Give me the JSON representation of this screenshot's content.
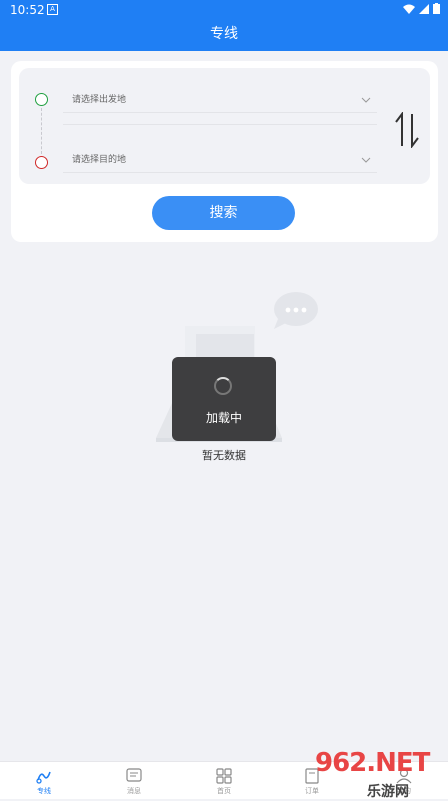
{
  "status_bar": {
    "time": "10:52",
    "notification_icon": "A"
  },
  "app_bar": {
    "title": "专线"
  },
  "route_form": {
    "from_placeholder": "请选择出发地",
    "to_placeholder": "请选择目的地",
    "search_label": "搜索",
    "from_dot_color": "#20a040",
    "to_dot_color": "#d02828"
  },
  "loading_toast": {
    "label": "加载中"
  },
  "empty_state": {
    "text": "暂无数据"
  },
  "tab_bar": {
    "items": [
      {
        "label": "专线",
        "icon": "route-icon",
        "active": true
      },
      {
        "label": "消息",
        "icon": "message-icon",
        "active": false
      },
      {
        "label": "首页",
        "icon": "grid-icon",
        "active": false
      },
      {
        "label": "订单",
        "icon": "order-icon",
        "active": false
      },
      {
        "label": "我的",
        "icon": "user-icon",
        "active": false
      }
    ]
  },
  "watermark": {
    "line1": "962.NET",
    "line2": "乐游网"
  },
  "colors": {
    "primary": "#1f7ff4",
    "button": "#3a8ff5",
    "background": "#f1f2f6"
  }
}
